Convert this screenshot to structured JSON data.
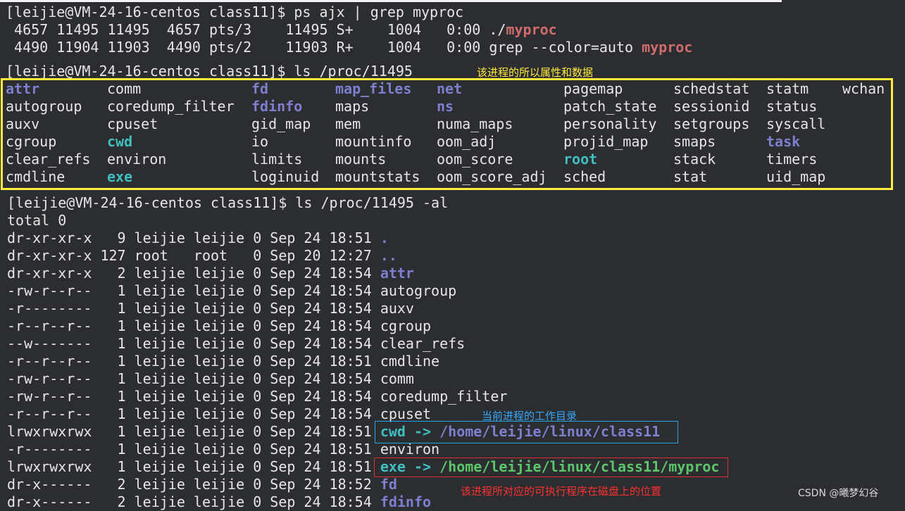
{
  "top": {
    "prompt": "[leijie@VM-24-16-centos class11]$ ps ajx | grep myproc",
    "ps_row1_prefix": " 4657 11495 11495  4657 pts/3    11495 S+    1004   0:00 ./",
    "ps_row1_hl": "myproc",
    "ps_row2_prefix": " 4490 11904 11903  4490 pts/2    11903 R+    1004   0:00 grep --color=auto ",
    "ps_row2_hl": "myproc"
  },
  "ls": {
    "prompt": "[leijie@VM-24-16-centos class11]$ ls /proc/11495",
    "annotation": "该进程的所以属性和数据",
    "columns": [
      [
        {
          "t": "attr",
          "k": "dir"
        },
        {
          "t": "autogroup",
          "k": "plain"
        },
        {
          "t": "auxv",
          "k": "plain"
        },
        {
          "t": "cgroup",
          "k": "plain"
        },
        {
          "t": "clear_refs",
          "k": "plain"
        },
        {
          "t": "cmdline",
          "k": "plain"
        }
      ],
      [
        {
          "t": "comm",
          "k": "plain"
        },
        {
          "t": "coredump_filter",
          "k": "plain"
        },
        {
          "t": "cpuset",
          "k": "plain"
        },
        {
          "t": "cwd",
          "k": "lnk"
        },
        {
          "t": "environ",
          "k": "plain"
        },
        {
          "t": "exe",
          "k": "lnk"
        }
      ],
      [
        {
          "t": "fd",
          "k": "dir"
        },
        {
          "t": "fdinfo",
          "k": "dir"
        },
        {
          "t": "gid_map",
          "k": "plain"
        },
        {
          "t": "io",
          "k": "plain"
        },
        {
          "t": "limits",
          "k": "plain"
        },
        {
          "t": "loginuid",
          "k": "plain"
        }
      ],
      [
        {
          "t": "map_files",
          "k": "dir"
        },
        {
          "t": "maps",
          "k": "plain"
        },
        {
          "t": "mem",
          "k": "plain"
        },
        {
          "t": "mountinfo",
          "k": "plain"
        },
        {
          "t": "mounts",
          "k": "plain"
        },
        {
          "t": "mountstats",
          "k": "plain"
        }
      ],
      [
        {
          "t": "net",
          "k": "dir"
        },
        {
          "t": "ns",
          "k": "dir"
        },
        {
          "t": "numa_maps",
          "k": "plain"
        },
        {
          "t": "oom_adj",
          "k": "plain"
        },
        {
          "t": "oom_score",
          "k": "plain"
        },
        {
          "t": "oom_score_adj",
          "k": "plain"
        }
      ],
      [
        {
          "t": "pagemap",
          "k": "plain"
        },
        {
          "t": "patch_state",
          "k": "plain"
        },
        {
          "t": "personality",
          "k": "plain"
        },
        {
          "t": "projid_map",
          "k": "plain"
        },
        {
          "t": "root",
          "k": "lnk"
        },
        {
          "t": "sched",
          "k": "plain"
        }
      ],
      [
        {
          "t": "schedstat",
          "k": "plain"
        },
        {
          "t": "sessionid",
          "k": "plain"
        },
        {
          "t": "setgroups",
          "k": "plain"
        },
        {
          "t": "smaps",
          "k": "plain"
        },
        {
          "t": "stack",
          "k": "plain"
        },
        {
          "t": "stat",
          "k": "plain"
        }
      ],
      [
        {
          "t": "statm",
          "k": "plain"
        },
        {
          "t": "status",
          "k": "plain"
        },
        {
          "t": "syscall",
          "k": "plain"
        },
        {
          "t": "task",
          "k": "dir"
        },
        {
          "t": "timers",
          "k": "plain"
        },
        {
          "t": "uid_map",
          "k": "plain"
        }
      ],
      [
        {
          "t": "wchan",
          "k": "plain"
        }
      ]
    ]
  },
  "lsal": {
    "prompt": "[leijie@VM-24-16-centos class11]$ ls /proc/11495 -al",
    "total": "total 0",
    "rows": [
      {
        "meta": "dr-xr-xr-x   9 leijie leijie 0 Sep 24 18:51 ",
        "name": ".",
        "k": "dir"
      },
      {
        "meta": "dr-xr-xr-x 127 root   root   0 Sep 20 12:27 ",
        "name": "..",
        "k": "dir"
      },
      {
        "meta": "dr-xr-xr-x   2 leijie leijie 0 Sep 24 18:54 ",
        "name": "attr",
        "k": "dir"
      },
      {
        "meta": "-rw-r--r--   1 leijie leijie 0 Sep 24 18:54 ",
        "name": "autogroup",
        "k": "plain"
      },
      {
        "meta": "-r--------   1 leijie leijie 0 Sep 24 18:54 ",
        "name": "auxv",
        "k": "plain"
      },
      {
        "meta": "-r--r--r--   1 leijie leijie 0 Sep 24 18:54 ",
        "name": "cgroup",
        "k": "plain"
      },
      {
        "meta": "--w-------   1 leijie leijie 0 Sep 24 18:54 ",
        "name": "clear_refs",
        "k": "plain"
      },
      {
        "meta": "-r--r--r--   1 leijie leijie 0 Sep 24 18:51 ",
        "name": "cmdline",
        "k": "plain"
      },
      {
        "meta": "-rw-r--r--   1 leijie leijie 0 Sep 24 18:54 ",
        "name": "comm",
        "k": "plain"
      },
      {
        "meta": "-rw-r--r--   1 leijie leijie 0 Sep 24 18:54 ",
        "name": "coredump_filter",
        "k": "plain"
      },
      {
        "meta": "-r--r--r--   1 leijie leijie 0 Sep 24 18:54 ",
        "name": "cpuset",
        "k": "plain"
      },
      {
        "meta": "lrwxrwxrwx   1 leijie leijie 0 Sep 24 18:51 ",
        "name": "cwd",
        "k": "lnk",
        "arrow": " -> ",
        "target": "/home/leijie/linux/class11",
        "tk": "dir"
      },
      {
        "meta": "-r--------   1 leijie leijie 0 Sep 24 18:51 ",
        "name": "environ",
        "k": "plain"
      },
      {
        "meta": "lrwxrwxrwx   1 leijie leijie 0 Sep 24 18:51 ",
        "name": "exe",
        "k": "lnk",
        "arrow": " -> ",
        "target": "/home/leijie/linux/class11/myproc",
        "tk": "exe"
      },
      {
        "meta": "dr-x------   2 leijie leijie 0 Sep 24 18:52 ",
        "name": "fd",
        "k": "dir"
      },
      {
        "meta": "dr-x------   2 leijie leijie 0 Sep 24 18:54 ",
        "name": "fdinfo",
        "k": "dir"
      }
    ]
  },
  "annotations": {
    "cwd_note": "当前进程的工作目录",
    "exe_note": "该进程所对应的可执行程序在磁盘上的位置"
  },
  "colors": {
    "yellow_box": "#ffeb3b",
    "blue_box": "#2aa4e0",
    "red_box": "#e03030",
    "cwd_note": "#34a8ff",
    "exe_note": "#ff3030",
    "ls_note": "#ffeb3b"
  },
  "watermark": "CSDN @曦梦幻谷"
}
